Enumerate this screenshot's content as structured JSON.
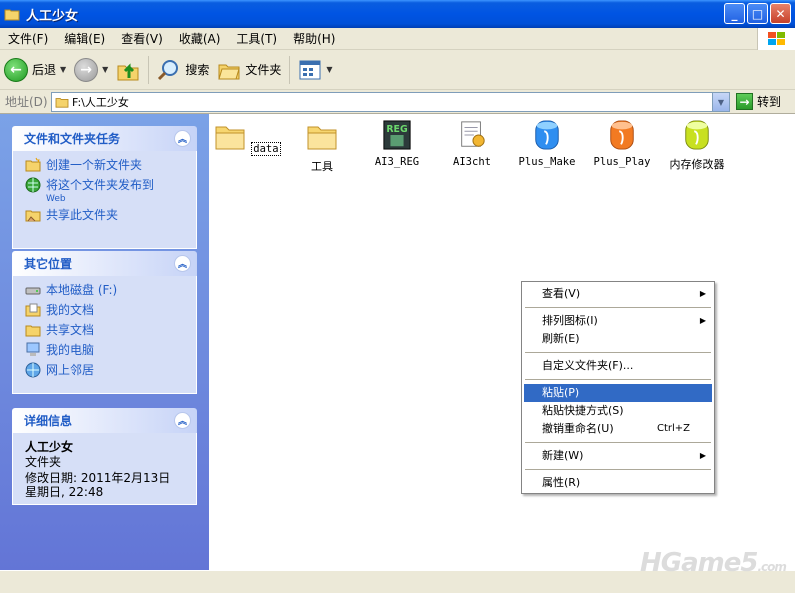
{
  "window": {
    "title": "人工少女"
  },
  "menubar": {
    "items": [
      "文件(F)",
      "编辑(E)",
      "查看(V)",
      "收藏(A)",
      "工具(T)",
      "帮助(H)"
    ]
  },
  "toolbar": {
    "back": "后退",
    "search": "搜索",
    "folders": "文件夹"
  },
  "address": {
    "label": "地址(D)",
    "value": "F:\\人工少女",
    "go": "转到"
  },
  "tasks": {
    "title": "文件和文件夹任务",
    "items": [
      "创建一个新文件夹",
      "将这个文件夹发布到",
      "Web",
      "共享此文件夹"
    ]
  },
  "places": {
    "title": "其它位置",
    "items": [
      "本地磁盘 (F:)",
      "我的文档",
      "共享文档",
      "我的电脑",
      "网上邻居"
    ]
  },
  "details": {
    "title": "详细信息",
    "name": "人工少女",
    "type": "文件夹",
    "modified_label": "修改日期: 2011年2月13日",
    "modified_time": "星期日, 22:48"
  },
  "files": [
    {
      "name": "data",
      "icon": "folder-icon"
    },
    {
      "name": "工具",
      "icon": "folder-icon"
    },
    {
      "name": "AI3_REG",
      "icon": "registry-icon"
    },
    {
      "name": "AI3cht",
      "icon": "config-file-icon"
    },
    {
      "name": "Plus_Make",
      "icon": "plus-make-icon"
    },
    {
      "name": "Plus_Play",
      "icon": "plus-play-icon"
    },
    {
      "name": "内存修改器",
      "icon": "memory-editor-icon"
    }
  ],
  "context_menu": {
    "view": "查看(V)",
    "arrange": "排列图标(I)",
    "refresh": "刷新(E)",
    "customize": "自定义文件夹(F)...",
    "paste": "粘贴(P)",
    "paste_shortcut": "粘贴快捷方式(S)",
    "undo_rename": "撤销重命名(U)",
    "undo_shortcut": "Ctrl+Z",
    "new": "新建(W)",
    "properties": "属性(R)"
  },
  "watermark": {
    "text": "HGame5",
    "suffix": ".com"
  }
}
